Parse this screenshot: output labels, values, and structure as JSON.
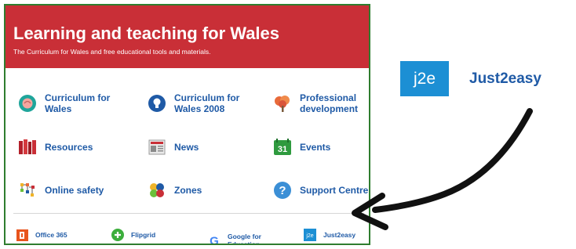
{
  "header": {
    "title": "Learning and teaching for Wales",
    "subtitle": "The Curriculum for Wales and free educational tools and materials."
  },
  "tiles": [
    {
      "label": "Curriculum for Wales",
      "icon": "brain-icon"
    },
    {
      "label": "Curriculum for Wales 2008",
      "icon": "lightbulb-icon"
    },
    {
      "label": "Professional development",
      "icon": "tree-icon"
    },
    {
      "label": "Resources",
      "icon": "books-icon"
    },
    {
      "label": "News",
      "icon": "newspaper-icon"
    },
    {
      "label": "Events",
      "icon": "calendar-icon",
      "icon_text": "31"
    },
    {
      "label": "Online safety",
      "icon": "network-icon"
    },
    {
      "label": "Zones",
      "icon": "pinwheel-icon"
    },
    {
      "label": "Support Centre",
      "icon": "question-icon",
      "icon_text": "?"
    }
  ],
  "tools": [
    {
      "label": "Office 365",
      "icon": "office-icon"
    },
    {
      "label": "Flipgrid",
      "icon": "flipgrid-icon"
    },
    {
      "label": "Google for Education",
      "icon": "google-icon",
      "icon_text": "G"
    },
    {
      "label": "Just2easy",
      "icon": "j2e-icon",
      "icon_text": "j2e"
    }
  ],
  "callout": {
    "logo_text": "j2e",
    "name": "Just2easy"
  },
  "colors": {
    "header_bg": "#c92f37",
    "link_blue": "#1f5aa6",
    "border_green": "#2f7d2f",
    "j2e_blue": "#1c8fd4"
  }
}
